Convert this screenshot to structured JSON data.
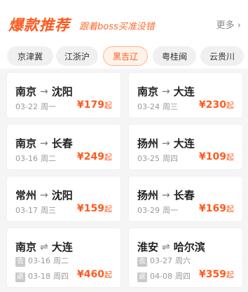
{
  "header": {
    "title": "爆款推荐",
    "slogan": "跟着boss买准没错",
    "more": "更多 ›"
  },
  "tabs": [
    {
      "label": "京津冀"
    },
    {
      "label": "江浙沪"
    },
    {
      "label": "黑吉辽",
      "active": true
    },
    {
      "label": "粤桂闽"
    },
    {
      "label": "云贵川"
    }
  ],
  "cards": [
    {
      "from": "南京",
      "to": "沈阳",
      "arrow": "→",
      "date": "03-22",
      "weekday": "周一",
      "price": "¥179",
      "unit": "起"
    },
    {
      "from": "南京",
      "to": "大连",
      "arrow": "→",
      "date": "03-24",
      "weekday": "周三",
      "price": "¥230",
      "unit": "起"
    },
    {
      "from": "南京",
      "to": "长春",
      "arrow": "→",
      "date": "03-16",
      "weekday": "周二",
      "price": "¥249",
      "unit": "起"
    },
    {
      "from": "扬州",
      "to": "大连",
      "arrow": "→",
      "date": "03-25",
      "weekday": "周四",
      "price": "¥109",
      "unit": "起"
    },
    {
      "from": "常州",
      "to": "沈阳",
      "arrow": "→",
      "date": "03-17",
      "weekday": "周三",
      "price": "¥159",
      "unit": "起"
    },
    {
      "from": "扬州",
      "to": "长春",
      "arrow": "→",
      "date": "03-29",
      "weekday": "周一",
      "price": "¥169",
      "unit": "起"
    },
    {
      "from": "南京",
      "to": "大连",
      "arrow": "⇌",
      "go_badge": "去",
      "go_date": "03-16",
      "go_weekday": "周二",
      "ret_badge": "返",
      "ret_date": "03-18",
      "ret_weekday": "周四",
      "price": "¥460",
      "unit": "起"
    },
    {
      "from": "淮安",
      "to": "哈尔滨",
      "arrow": "⇌",
      "go_badge": "去",
      "go_date": "03-27",
      "go_weekday": "周六",
      "ret_badge": "返",
      "ret_date": "04-08",
      "ret_weekday": "周四",
      "price": "¥359",
      "unit": "起"
    }
  ]
}
